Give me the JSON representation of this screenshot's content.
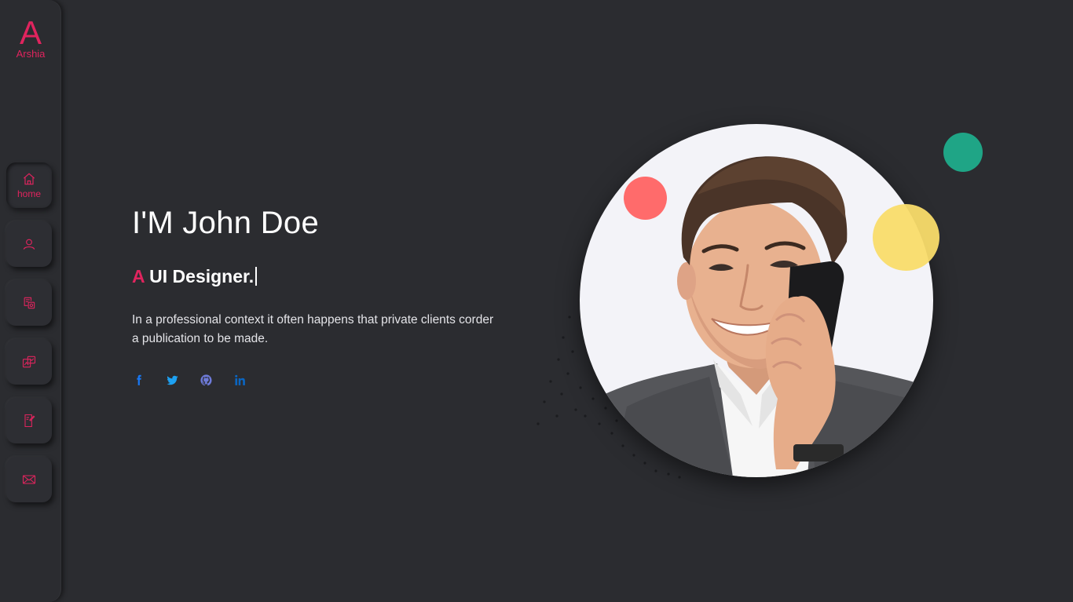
{
  "brand": {
    "letter": "A",
    "name": "Arshia"
  },
  "nav": {
    "items": [
      {
        "id": "home",
        "label": "home",
        "icon": "home-icon",
        "active": true
      },
      {
        "id": "about",
        "label": "",
        "icon": "user-icon",
        "active": false
      },
      {
        "id": "services",
        "label": "",
        "icon": "service-icon",
        "active": false
      },
      {
        "id": "portfolio",
        "label": "",
        "icon": "portfolio-icon",
        "active": false
      },
      {
        "id": "blog",
        "label": "",
        "icon": "blog-icon",
        "active": false
      },
      {
        "id": "contact",
        "label": "",
        "icon": "mail-icon",
        "active": false
      }
    ]
  },
  "hero": {
    "title": "I'M John Doe",
    "subtitle_accent": "A",
    "subtitle_text": "UI Designer.",
    "description": "In a professional context it often happens that private clients corder a publication to be made."
  },
  "social": [
    {
      "name": "facebook",
      "icon": "facebook-icon",
      "color": "#1877f2"
    },
    {
      "name": "twitter",
      "icon": "twitter-icon",
      "color": "#1da1f2"
    },
    {
      "name": "github",
      "icon": "github-icon",
      "color": "#6e7bd9"
    },
    {
      "name": "linkedin",
      "icon": "linkedin-icon",
      "color": "#0a66c2"
    }
  ],
  "colors": {
    "accent": "#e0245e",
    "background": "#2b2c30",
    "bubble_red": "#ff6b6b",
    "bubble_yellow": "#f9dc6a",
    "bubble_green": "#1fa586"
  }
}
